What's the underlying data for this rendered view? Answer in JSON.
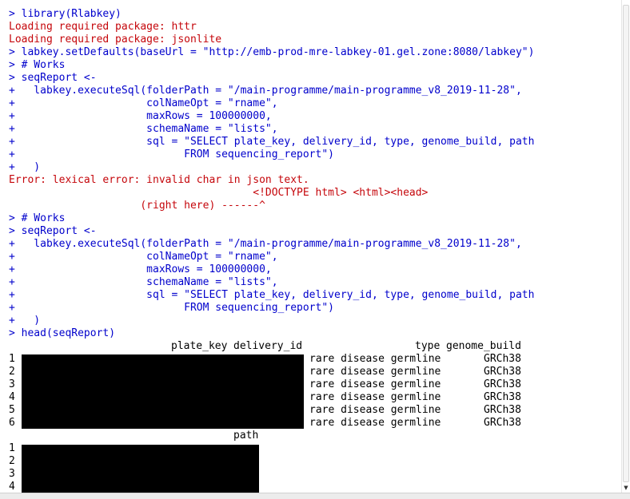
{
  "console": {
    "lines": [
      {
        "kind": "in",
        "text": "> library(Rlabkey)"
      },
      {
        "kind": "err",
        "text": "Loading required package: httr"
      },
      {
        "kind": "err",
        "text": "Loading required package: jsonlite"
      },
      {
        "kind": "in",
        "text": "> labkey.setDefaults(baseUrl = \"http://emb-prod-mre-labkey-01.gel.zone:8080/labkey\")"
      },
      {
        "kind": "in",
        "text": "> # Works"
      },
      {
        "kind": "in",
        "text": "> seqReport <-"
      },
      {
        "kind": "in",
        "text": "+   labkey.executeSql(folderPath = \"/main-programme/main-programme_v8_2019-11-28\","
      },
      {
        "kind": "in",
        "text": "+                     colNameOpt = \"rname\","
      },
      {
        "kind": "in",
        "text": "+                     maxRows = 100000000,"
      },
      {
        "kind": "in",
        "text": "+                     schemaName = \"lists\","
      },
      {
        "kind": "in",
        "text": "+                     sql = \"SELECT plate_key, delivery_id, type, genome_build, path"
      },
      {
        "kind": "in",
        "text": "+                           FROM sequencing_report\")"
      },
      {
        "kind": "in",
        "text": "+   )"
      },
      {
        "kind": "err",
        "text": "Error: lexical error: invalid char in json text."
      },
      {
        "kind": "err",
        "text": "                                       <!DOCTYPE html> <html><head>"
      },
      {
        "kind": "err",
        "text": "                     (right here) ------^"
      },
      {
        "kind": "in",
        "text": "> # Works"
      },
      {
        "kind": "in",
        "text": "> seqReport <-"
      },
      {
        "kind": "in",
        "text": "+   labkey.executeSql(folderPath = \"/main-programme/main-programme_v8_2019-11-28\","
      },
      {
        "kind": "in",
        "text": "+                     colNameOpt = \"rname\","
      },
      {
        "kind": "in",
        "text": "+                     maxRows = 100000000,"
      },
      {
        "kind": "in",
        "text": "+                     schemaName = \"lists\","
      },
      {
        "kind": "in",
        "text": "+                     sql = \"SELECT plate_key, delivery_id, type, genome_build, path"
      },
      {
        "kind": "in",
        "text": "+                           FROM sequencing_report\")"
      },
      {
        "kind": "in",
        "text": "+   )"
      },
      {
        "kind": "in",
        "text": "> head(seqReport)"
      }
    ],
    "table1": {
      "headers": {
        "plate_key": "plate_key",
        "delivery_id": "delivery_id",
        "type": "type",
        "genome_build": "genome_build"
      },
      "rows": [
        {
          "n": "1",
          "type": "rare disease germline",
          "genome_build": "GRCh38"
        },
        {
          "n": "2",
          "type": "rare disease germline",
          "genome_build": "GRCh38"
        },
        {
          "n": "3",
          "type": "rare disease germline",
          "genome_build": "GRCh38"
        },
        {
          "n": "4",
          "type": "rare disease germline",
          "genome_build": "GRCh38"
        },
        {
          "n": "5",
          "type": "rare disease germline",
          "genome_build": "GRCh38"
        },
        {
          "n": "6",
          "type": "rare disease germline",
          "genome_build": "GRCh38"
        }
      ]
    },
    "table2": {
      "header": "path",
      "rows": [
        "1",
        "2",
        "3",
        "4"
      ]
    }
  },
  "colors": {
    "input": "#0000cc",
    "error": "#c5060b",
    "output": "#000000",
    "redaction": "#000000"
  }
}
